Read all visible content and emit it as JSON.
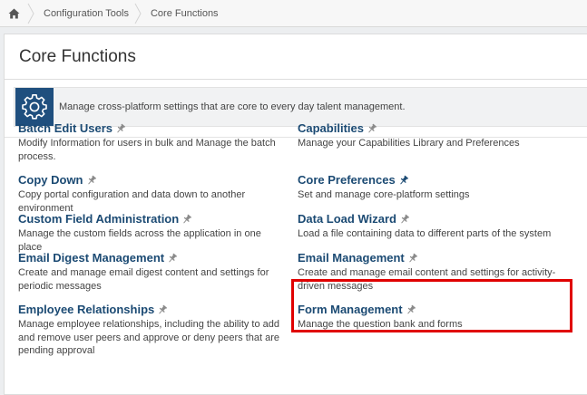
{
  "breadcrumb": {
    "items": [
      "Configuration Tools",
      "Core Functions"
    ]
  },
  "page": {
    "title": "Core Functions",
    "description": "Manage cross-platform settings that are core to every day talent management."
  },
  "functions": [
    {
      "title": "Batch Edit Users",
      "desc": "Modify Information for users in bulk and Manage the batch process.",
      "pinned": false
    },
    {
      "title": "Capabilities",
      "desc": "Manage your Capabilities Library and Preferences",
      "pinned": false
    },
    {
      "title": "Copy Down",
      "desc": "Copy portal configuration and data down to another environment",
      "pinned": false
    },
    {
      "title": "Core Preferences",
      "desc": "Set and manage core-platform settings",
      "pinned": true
    },
    {
      "title": "Custom Field Administration",
      "desc": "Manage the custom fields across the application in one place",
      "pinned": false
    },
    {
      "title": "Data Load Wizard",
      "desc": "Load a file containing data to different parts of the system",
      "pinned": false
    },
    {
      "title": "Email Digest Management",
      "desc": "Create and manage email digest content and settings for periodic messages",
      "pinned": false
    },
    {
      "title": "Email Management",
      "desc": "Create and manage email content and settings for activity-driven messages",
      "pinned": false
    },
    {
      "title": "Employee Relationships",
      "desc": "Manage employee relationships, including the ability to add and remove user peers and approve or deny peers that are pending approval",
      "pinned": false
    },
    {
      "title": "Form Management",
      "desc": "Manage the question bank and forms",
      "pinned": false
    }
  ],
  "colors": {
    "link": "#1b4a73",
    "gear_bg": "#1f4f7e",
    "highlight": "#e00000"
  }
}
